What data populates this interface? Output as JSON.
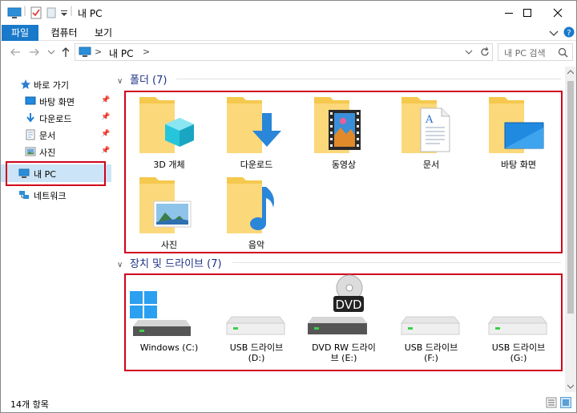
{
  "window": {
    "title": "내 PC"
  },
  "ribbon": {
    "tabs": [
      {
        "label": "파일"
      },
      {
        "label": "컴퓨터"
      },
      {
        "label": "보기"
      }
    ]
  },
  "address": {
    "path_root": ">",
    "path": "내 PC",
    "path_sep": ">"
  },
  "search": {
    "placeholder": "내 PC 검색"
  },
  "nav": {
    "quick_access": "바로 가기",
    "items": [
      {
        "label": "바탕 화면",
        "pinned": true
      },
      {
        "label": "다운로드",
        "pinned": true
      },
      {
        "label": "문서",
        "pinned": true
      },
      {
        "label": "사진",
        "pinned": true
      }
    ],
    "this_pc": "내 PC",
    "network": "네트워크"
  },
  "folders": {
    "header": "폴더 (7)",
    "items": [
      {
        "label": "3D 개체",
        "icon": "3d-objects-icon"
      },
      {
        "label": "다운로드",
        "icon": "downloads-icon"
      },
      {
        "label": "동영상",
        "icon": "videos-icon"
      },
      {
        "label": "문서",
        "icon": "documents-icon"
      },
      {
        "label": "바탕 화면",
        "icon": "desktop-icon"
      },
      {
        "label": "사진",
        "icon": "pictures-icon"
      },
      {
        "label": "음악",
        "icon": "music-icon"
      }
    ]
  },
  "drives": {
    "header": "장치 및 드라이브 (7)",
    "items": [
      {
        "label": "Windows (C:)",
        "icon": "system-drive-icon"
      },
      {
        "label": "USB 드라이브",
        "sub": "(D:)",
        "icon": "usb-drive-icon"
      },
      {
        "label": "DVD RW 드라이",
        "sub": "브 (E:)",
        "icon": "dvd-drive-icon",
        "badge": "DVD"
      },
      {
        "label": "USB 드라이브",
        "sub": "(F:)",
        "icon": "usb-drive-icon"
      },
      {
        "label": "USB 드라이브",
        "sub": "(G:)",
        "icon": "usb-drive-icon"
      }
    ]
  },
  "status": {
    "text": "14개 항목"
  },
  "colors": {
    "accent": "#1979ca",
    "highlight": "#d0021b",
    "folder": "#f5c94e"
  }
}
